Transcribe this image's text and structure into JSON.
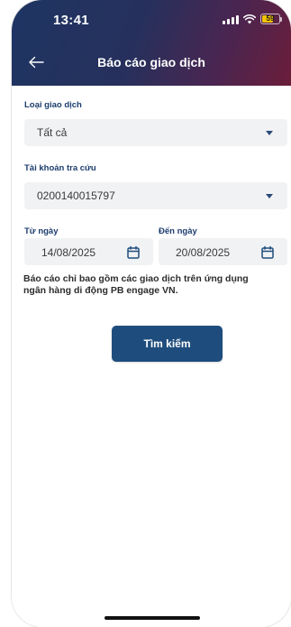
{
  "status_bar": {
    "time": "13:41",
    "battery_level": "59"
  },
  "header": {
    "title": "Báo cáo giao dịch"
  },
  "form": {
    "transaction_type": {
      "label": "Loại giao dịch",
      "value": "Tất cả"
    },
    "account": {
      "label": "Tài khoản tra cứu",
      "value": "0200140015797"
    },
    "from_date": {
      "label": "Từ ngày",
      "value": "14/08/2025"
    },
    "to_date": {
      "label": "Đến ngày",
      "value": "20/08/2025"
    },
    "note_line_1": "Báo cáo chỉ bao gồm các giao dịch trên ứng dụng",
    "note_line_2": "ngân hàng di động PB engage VN.",
    "search_label": "Tìm kiếm"
  },
  "colors": {
    "header_gradient_start": "#1e3563",
    "header_gradient_end": "#6b1d3a",
    "label": "#1c3d6e",
    "primary_button": "#1e4d7d",
    "field_background": "#f1f2f4"
  },
  "icons": {
    "back": "arrow-left-icon",
    "dropdown": "caret-down-icon",
    "date": "calendar-icon"
  }
}
